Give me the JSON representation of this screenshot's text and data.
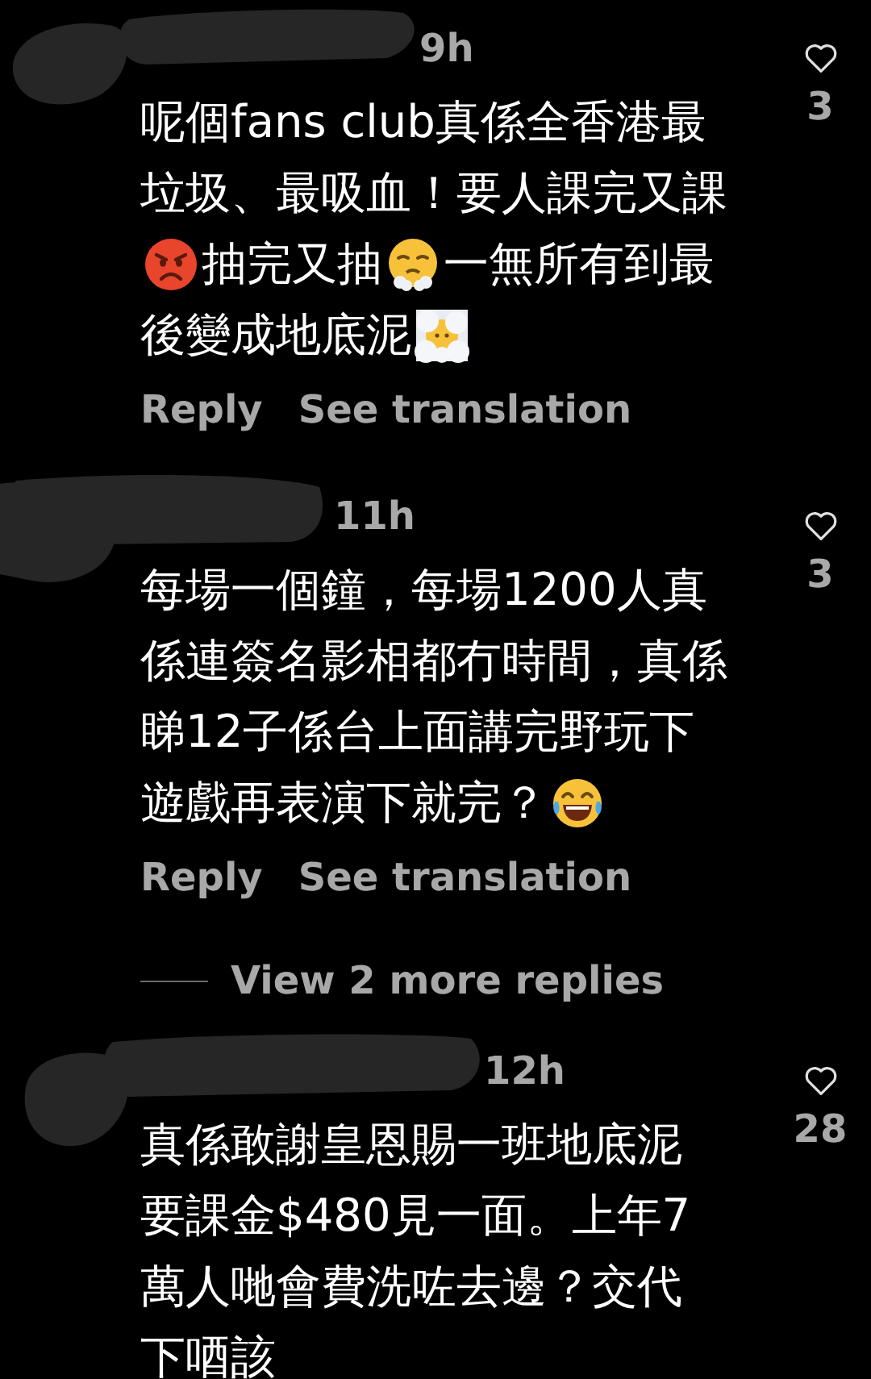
{
  "comments": [
    {
      "time": "9h",
      "likes": "3",
      "lines": [
        [
          {
            "kind": "text",
            "text": "呢個fans club真係全香港最"
          }
        ],
        [
          {
            "kind": "text",
            "text": "垃圾、最吸血！要人課完又課"
          }
        ],
        [
          {
            "kind": "angry"
          },
          {
            "kind": "text",
            "text": "抽完又抽"
          },
          {
            "kind": "steam"
          },
          {
            "kind": "text",
            "text": "一無所有到最"
          }
        ],
        [
          {
            "kind": "text",
            "text": "後變成地底泥"
          },
          {
            "kind": "cloud"
          }
        ]
      ],
      "actions": [
        "Reply",
        "See translation"
      ]
    },
    {
      "time": "11h",
      "likes": "3",
      "lines": [
        [
          {
            "kind": "text",
            "text": "每場一個鐘，每場1200人真"
          }
        ],
        [
          {
            "kind": "text",
            "text": "係連簽名影相都冇時間，真係"
          }
        ],
        [
          {
            "kind": "text",
            "text": "睇12子係台上面講完野玩下"
          }
        ],
        [
          {
            "kind": "text",
            "text": "遊戲再表演下就完？"
          },
          {
            "kind": "laugh"
          }
        ]
      ],
      "actions": [
        "Reply",
        "See translation"
      ],
      "more_replies": "View 2 more replies"
    },
    {
      "time": "12h",
      "likes": "28",
      "lines": [
        [
          {
            "kind": "text",
            "text": "真係敢謝皇恩賜一班地底泥"
          }
        ],
        [
          {
            "kind": "text",
            "text": "要課金$480見一面。上年7"
          }
        ],
        [
          {
            "kind": "text",
            "text": "萬人哋會費洗咗去邊？交代"
          }
        ],
        [
          {
            "kind": "text",
            "text": "下唒該"
          }
        ]
      ]
    }
  ]
}
